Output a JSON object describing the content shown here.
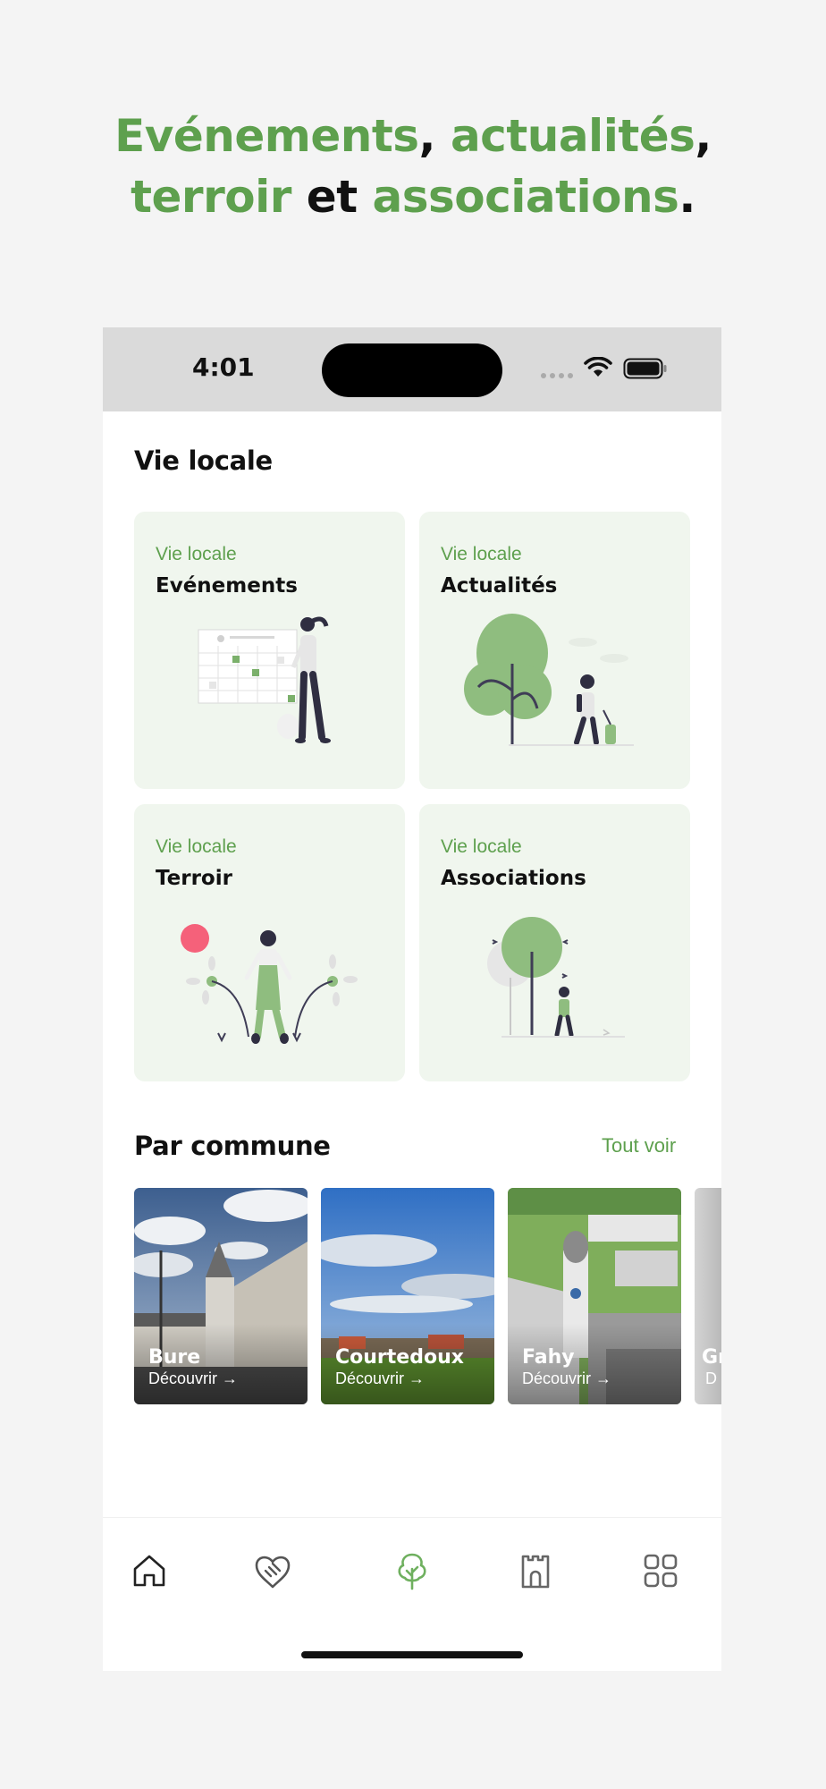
{
  "headline": {
    "line1": [
      {
        "text": "Evénements",
        "green": true
      },
      {
        "text": ", ",
        "green": false
      },
      {
        "text": "actualités",
        "green": true
      },
      {
        "text": ",",
        "green": false
      }
    ],
    "line2": [
      {
        "text": "terroir",
        "green": true
      },
      {
        "text": " et ",
        "green": false
      },
      {
        "text": "associations",
        "green": true
      },
      {
        "text": ".",
        "green": false
      }
    ]
  },
  "status": {
    "time": "4:01"
  },
  "vie_locale": {
    "title": "Vie locale",
    "cards": [
      {
        "category": "Vie locale",
        "name": "Evénements"
      },
      {
        "category": "Vie locale",
        "name": "Actualités"
      },
      {
        "category": "Vie locale",
        "name": "Terroir"
      },
      {
        "category": "Vie locale",
        "name": "Associations"
      }
    ]
  },
  "par_commune": {
    "title": "Par commune",
    "see_all": "Tout voir",
    "items": [
      {
        "name": "Bure",
        "action": "Découvrir →"
      },
      {
        "name": "Courtedoux",
        "action": "Découvrir →"
      },
      {
        "name": "Fahy",
        "action": "Découvrir →"
      },
      {
        "name": "Gr",
        "action": "D"
      }
    ]
  },
  "tabs": [
    {
      "icon": "home-icon",
      "active": false
    },
    {
      "icon": "handshake-icon",
      "active": false
    },
    {
      "icon": "tree-icon",
      "active": true
    },
    {
      "icon": "castle-icon",
      "active": false
    },
    {
      "icon": "grid-icon",
      "active": false
    }
  ],
  "colors": {
    "accent": "#5ea04e",
    "card_bg": "#f0f6ee",
    "statusbar": "#dadada",
    "background": "#f4f4f4"
  }
}
